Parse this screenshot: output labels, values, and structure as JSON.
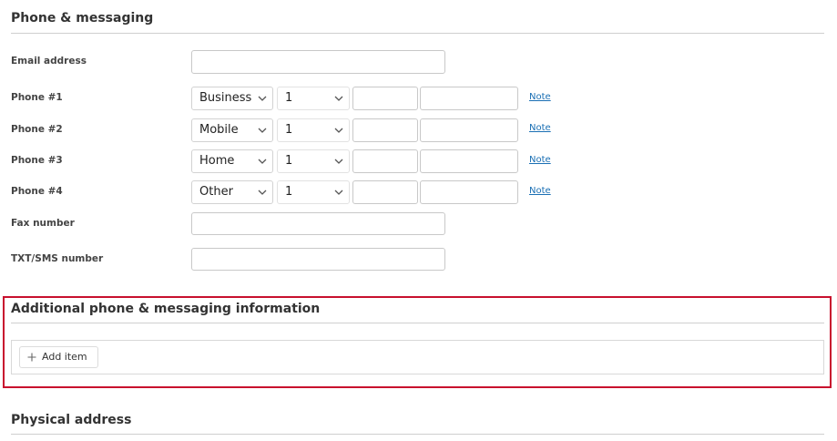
{
  "phone_section": {
    "title": "Phone & messaging",
    "email": {
      "label": "Email address",
      "value": ""
    },
    "phones": [
      {
        "label": "Phone #1",
        "type": "Business",
        "country_code": "1",
        "area": "",
        "number": "",
        "note": "Note"
      },
      {
        "label": "Phone #2",
        "type": "Mobile",
        "country_code": "1",
        "area": "",
        "number": "",
        "note": "Note"
      },
      {
        "label": "Phone #3",
        "type": "Home",
        "country_code": "1",
        "area": "",
        "number": "",
        "note": "Note"
      },
      {
        "label": "Phone #4",
        "type": "Other",
        "country_code": "1",
        "area": "",
        "number": "",
        "note": "Note"
      }
    ],
    "fax": {
      "label": "Fax number",
      "value": ""
    },
    "sms": {
      "label": "TXT/SMS number",
      "value": ""
    }
  },
  "additional_section": {
    "title": "Additional phone & messaging information",
    "add_item_label": "Add item",
    "highlight_color": "#c8102e"
  },
  "address_section": {
    "title": "Physical address"
  }
}
